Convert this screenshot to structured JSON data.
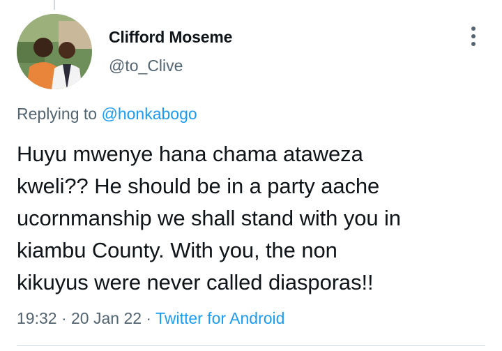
{
  "author": {
    "display_name": "Clifford Moseme",
    "handle": "@to_Clive",
    "avatar_icon": "profile-photo"
  },
  "reply": {
    "prefix": "Replying to ",
    "mention": "@honkabogo"
  },
  "tweet": {
    "text": "Huyu mwenye hana chama ataweza\nkweli?? He should be in a party aache\nucornmanship we shall stand with you in\nkiambu County. With you, the non\nkikuyus were never called diasporas!!"
  },
  "meta": {
    "time": "19:32",
    "separator1": " · ",
    "date": "20 Jan 22",
    "separator2": " · ",
    "source": "Twitter for Android"
  },
  "icons": {
    "more": "more-vertical-icon"
  },
  "colors": {
    "link": "#1d9bf0",
    "secondary_text": "#536471",
    "primary_text": "#0f1419",
    "divider": "#cfd9de"
  }
}
